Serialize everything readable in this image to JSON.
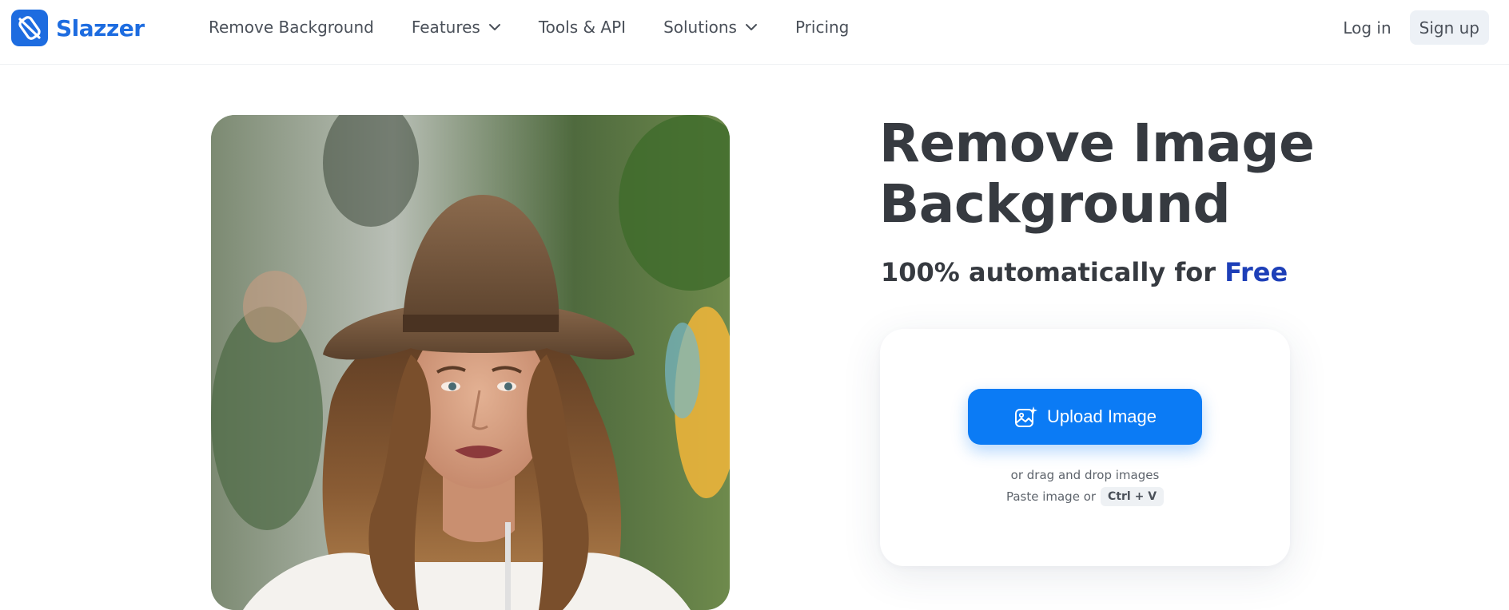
{
  "brand": {
    "name": "Slazzer",
    "color": "#1d6ce0"
  },
  "nav": {
    "items": [
      {
        "label": "Remove Background",
        "has_dropdown": false
      },
      {
        "label": "Features",
        "has_dropdown": true
      },
      {
        "label": "Tools & API",
        "has_dropdown": false
      },
      {
        "label": "Solutions",
        "has_dropdown": true
      },
      {
        "label": "Pricing",
        "has_dropdown": false
      }
    ]
  },
  "auth": {
    "login_label": "Log in",
    "signup_label": "Sign up"
  },
  "hero": {
    "title_line1": "Remove Image",
    "title_line2": "Background",
    "subtitle_prefix": "100% automatically for ",
    "subtitle_highlight": "Free",
    "highlight_color": "#1d3fb8"
  },
  "upload": {
    "button_label": "Upload Image",
    "button_icon": "image-sparkle-icon",
    "button_color": "#0b7bf5",
    "drag_text": "or drag and drop images",
    "paste_text": "Paste image or",
    "shortcut": "Ctrl + V"
  }
}
